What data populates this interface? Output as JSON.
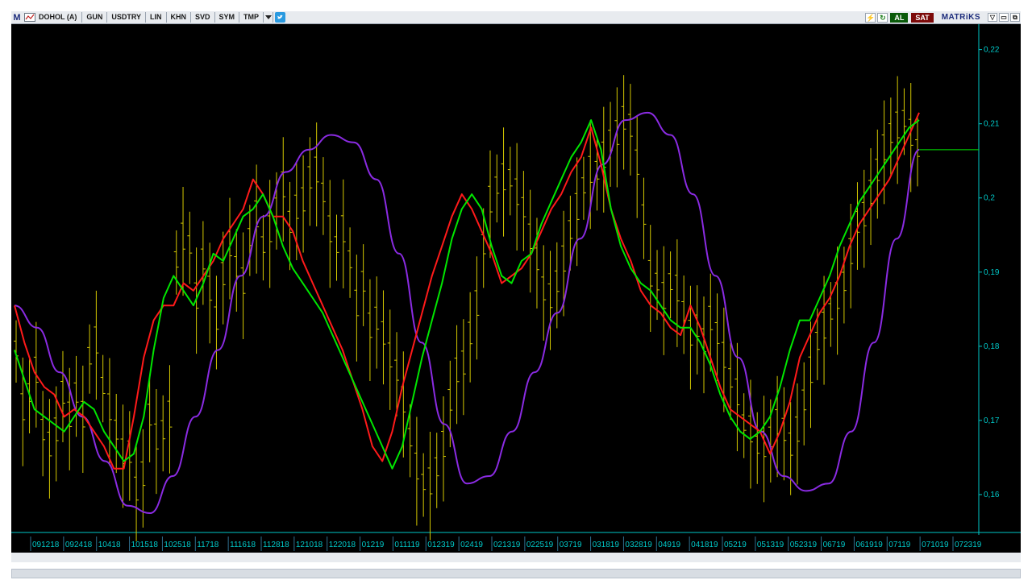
{
  "toolbar": {
    "logo": "M",
    "symbol": "DOHOL (A)",
    "buttons": [
      "GUN",
      "USDTRY",
      "LIN",
      "KHN",
      "SVD",
      "SYM",
      "TMP"
    ],
    "buy_label": "AL",
    "sell_label": "SAT",
    "brand": "MATRiKS"
  },
  "colors": {
    "background": "#000000",
    "price_bars": "#d4c800",
    "fast_ma": "#00e600",
    "slow_ma": "#ff1a1a",
    "cycle_line": "#8a2be2",
    "axis": "#00c8c8",
    "buy": "#0a5a0a",
    "sell": "#7c0a0a"
  },
  "chart_data": {
    "type": "line",
    "ylim": [
      0.155,
      0.223
    ],
    "y_ticks": [
      "0,16",
      "0,17",
      "0,18",
      "0,19",
      "0,2",
      "0,21",
      "0,22"
    ],
    "x_tick_labels": [
      "091218",
      "092418",
      "10418",
      "101518",
      "102518",
      "11718",
      "111618",
      "112818",
      "121018",
      "122018",
      "01219",
      "011119",
      "012319",
      "02419",
      "021319",
      "022519",
      "03719",
      "031819",
      "032819",
      "04919",
      "041819",
      "05219",
      "051319",
      "052319",
      "06719",
      "061919",
      "07119",
      "071019",
      "072319"
    ],
    "last_price": 0.2065,
    "series": [
      {
        "kind": "price_bars",
        "values": [
          0.1795,
          0.1715,
          0.1735,
          0.1765,
          0.1685,
          0.1665,
          0.1685,
          0.1735,
          0.1705,
          0.1735,
          0.1705,
          0.1785,
          0.1805,
          0.1745,
          0.1715,
          0.1685,
          0.1655,
          0.1655,
          0.1605,
          0.1625,
          0.1705,
          0.1675,
          0.1685,
          0.1705,
          0.1915,
          0.1945,
          0.1935,
          0.1865,
          0.1915,
          0.1875,
          0.1835,
          0.1895,
          0.1935,
          0.1905,
          0.1885,
          0.1945,
          0.1975,
          0.1935,
          0.1955,
          0.1985,
          0.2015,
          0.1965,
          0.1985,
          0.1995,
          0.2025,
          0.2035,
          0.2005,
          0.1955,
          0.1935,
          0.1955,
          0.1915,
          0.1855,
          0.1885,
          0.1825,
          0.1835,
          0.1815,
          0.1785,
          0.1765,
          0.1725,
          0.1675,
          0.1635,
          0.1615,
          0.1615,
          0.1635,
          0.1665,
          0.1725,
          0.1765,
          0.1775,
          0.1815,
          0.1855,
          0.1935,
          0.1995,
          0.2015,
          0.2025,
          0.2025,
          0.2005,
          0.1985,
          0.1945,
          0.1915,
          0.1875,
          0.1865,
          0.1885,
          0.1915,
          0.1955,
          0.1985,
          0.2015,
          0.2035,
          0.2035,
          0.2055,
          0.2075,
          0.2085,
          0.2105,
          0.2095,
          0.2045,
          0.1975,
          0.1895,
          0.1885,
          0.1865,
          0.1885,
          0.1875,
          0.1845,
          0.1815,
          0.1825,
          0.1805,
          0.1835,
          0.1815,
          0.1785,
          0.1755,
          0.1735,
          0.1695,
          0.1685,
          0.1665,
          0.1665,
          0.1675,
          0.1695,
          0.1685,
          0.1665,
          0.1685,
          0.1725,
          0.1765,
          0.1805,
          0.1825,
          0.1845,
          0.1865,
          0.1885,
          0.1925,
          0.1965,
          0.1975,
          0.2005,
          0.2035,
          0.2065,
          0.2085,
          0.2095,
          0.2105,
          0.2085,
          0.2065
        ]
      },
      {
        "kind": "fast_ma",
        "values": [
          0.1795,
          0.1755,
          0.1715,
          0.1705,
          0.1695,
          0.1685,
          0.1705,
          0.1725,
          0.1715,
          0.1685,
          0.1665,
          0.1645,
          0.1655,
          0.1705,
          0.1795,
          0.1865,
          0.1895,
          0.1875,
          0.1855,
          0.1885,
          0.1925,
          0.1915,
          0.1945,
          0.1975,
          0.1985,
          0.2005,
          0.1975,
          0.1935,
          0.1905,
          0.1885,
          0.1865,
          0.1845,
          0.1815,
          0.1785,
          0.1755,
          0.1725,
          0.1695,
          0.1665,
          0.1635,
          0.1665,
          0.1725,
          0.1785,
          0.1835,
          0.1885,
          0.1945,
          0.1985,
          0.2005,
          0.1985,
          0.1935,
          0.1895,
          0.1885,
          0.1915,
          0.1925,
          0.1965,
          0.1995,
          0.2025,
          0.2055,
          0.2075,
          0.2105,
          0.2065,
          0.1985,
          0.1935,
          0.1905,
          0.1885,
          0.1875,
          0.1855,
          0.1835,
          0.1825,
          0.1825,
          0.1805,
          0.1775,
          0.1735,
          0.1705,
          0.1685,
          0.1675,
          0.1685,
          0.1705,
          0.1745,
          0.1795,
          0.1835,
          0.1835,
          0.1865,
          0.1895,
          0.1935,
          0.1965,
          0.1995,
          0.2015,
          0.2035,
          0.2055,
          0.2075,
          0.2095,
          0.2105
        ]
      },
      {
        "kind": "slow_ma",
        "values": [
          0.1855,
          0.1805,
          0.1765,
          0.1745,
          0.1735,
          0.1705,
          0.1715,
          0.1705,
          0.1685,
          0.1665,
          0.1635,
          0.1635,
          0.1705,
          0.1785,
          0.1835,
          0.1855,
          0.1855,
          0.1885,
          0.1875,
          0.1895,
          0.1915,
          0.1945,
          0.1965,
          0.1985,
          0.2025,
          0.2005,
          0.1975,
          0.1975,
          0.1955,
          0.1915,
          0.1885,
          0.1855,
          0.1825,
          0.1795,
          0.1755,
          0.1715,
          0.1665,
          0.1645,
          0.1685,
          0.1745,
          0.1795,
          0.1845,
          0.1895,
          0.1935,
          0.1975,
          0.2005,
          0.1985,
          0.1955,
          0.1925,
          0.1885,
          0.1895,
          0.1905,
          0.1925,
          0.1955,
          0.1985,
          0.2005,
          0.2035,
          0.2055,
          0.2095,
          0.2045,
          0.1985,
          0.1945,
          0.1915,
          0.1875,
          0.1855,
          0.1845,
          0.1825,
          0.1815,
          0.1855,
          0.1825,
          0.1785,
          0.1745,
          0.1715,
          0.1705,
          0.1695,
          0.1685,
          0.1655,
          0.1685,
          0.1725,
          0.1785,
          0.1815,
          0.1845,
          0.1865,
          0.1895,
          0.1935,
          0.1965,
          0.1985,
          0.2005,
          0.2025,
          0.2055,
          0.2085,
          0.2115
        ]
      },
      {
        "kind": "cycle",
        "values": [
          0.1855,
          0.1825,
          0.1765,
          0.1705,
          0.1645,
          0.1585,
          0.1575,
          0.1625,
          0.1705,
          0.1795,
          0.1895,
          0.1975,
          0.2035,
          0.2065,
          0.2085,
          0.2075,
          0.2025,
          0.1925,
          0.1805,
          0.1695,
          0.1615,
          0.1625,
          0.1685,
          0.1765,
          0.1845,
          0.1945,
          0.2045,
          0.2105,
          0.2115,
          0.2085,
          0.2005,
          0.1895,
          0.1785,
          0.1685,
          0.1625,
          0.1605,
          0.1615,
          0.1685,
          0.1805,
          0.1945,
          0.2065
        ]
      }
    ]
  }
}
